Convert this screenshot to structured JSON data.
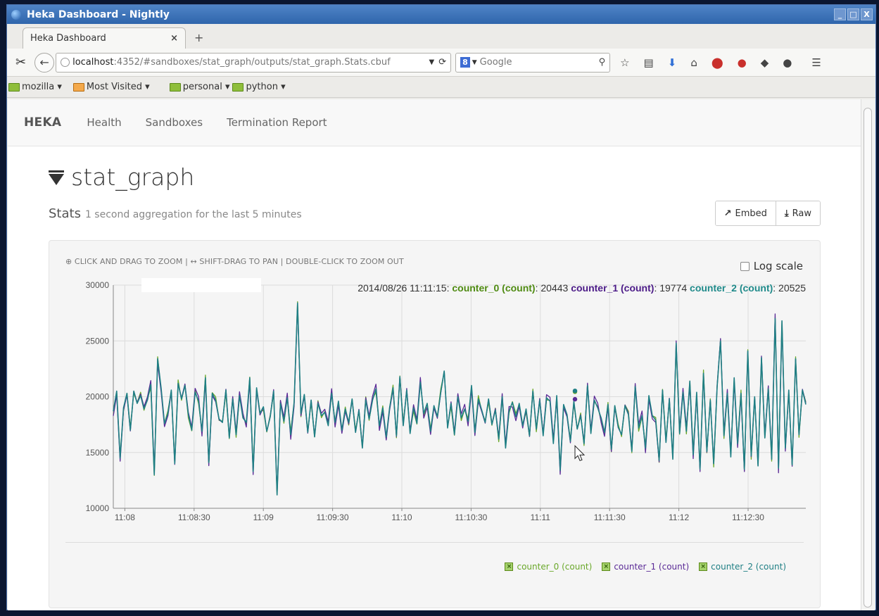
{
  "window": {
    "title": "Heka Dashboard - Nightly",
    "buttons": [
      "_",
      "□",
      "X"
    ]
  },
  "tabs": [
    {
      "label": "Heka Dashboard",
      "close": "×"
    }
  ],
  "newtab_icon": "+",
  "address": {
    "host": "localhost",
    "path": ":4352/#sandboxes/stat_graph/outputs/stat_graph.Stats.cbuf"
  },
  "search": {
    "engine_badge": "8",
    "placeholder": "Google"
  },
  "bookmarks": [
    {
      "label": "mozilla ▾",
      "icon": "folder-icon"
    },
    {
      "label": "Most Visited ▾",
      "icon": "most-visited-icon"
    },
    {
      "label": "personal ▾",
      "icon": "folder-icon"
    },
    {
      "label": "python ▾",
      "icon": "folder-icon"
    }
  ],
  "app": {
    "brand": "HEKA",
    "nav": [
      "Health",
      "Sandboxes",
      "Termination Report"
    ]
  },
  "page": {
    "title": "stat_graph",
    "section_title": "Stats",
    "section_subtitle": "1 second aggregation for the last 5 minutes",
    "embed_label": "Embed",
    "raw_label": "Raw"
  },
  "chart_panel": {
    "hint": "CLICK AND DRAG TO ZOOM | ↔ SHIFT-DRAG TO PAN | DOUBLE-CLICK TO ZOOM OUT",
    "log_scale_label": "Log scale"
  },
  "hover": {
    "time": "2014/08/26 11:11:15:",
    "items": [
      {
        "name": "counter_0 (count)",
        "value": "20443",
        "color": "#4e8a11"
      },
      {
        "name": "counter_1 (count)",
        "value": "19774",
        "color": "#4b1a87"
      },
      {
        "name": "counter_2 (count)",
        "value": "20525",
        "color": "#1f8a8a"
      }
    ]
  },
  "chart_data": {
    "type": "line",
    "title": "",
    "xlabel": "",
    "ylabel": "",
    "ylim": [
      10000,
      30000
    ],
    "yticks": [
      10000,
      15000,
      20000,
      25000,
      30000
    ],
    "xlim": [
      "11:07:55",
      "11:12:55"
    ],
    "xtick_labels": [
      "11:08",
      "11:08:30",
      "11:09",
      "11:09:30",
      "11:10",
      "11:10:30",
      "11:11",
      "11:11:30",
      "11:12",
      "11:12:30"
    ],
    "grid": true,
    "legend_position": "bottom-right",
    "series": [
      {
        "name": "counter_0 (count)",
        "color": "#6aa82a"
      },
      {
        "name": "counter_1 (count)",
        "color": "#5a2a96"
      },
      {
        "name": "counter_2 (count)",
        "color": "#1f7f84"
      }
    ],
    "base_values": [
      18700,
      20500,
      14500,
      19000,
      20300,
      17000,
      20500,
      19400,
      20100,
      18900,
      19700,
      21100,
      13000,
      23400,
      20800,
      17600,
      18500,
      20600,
      14000,
      21200,
      19800,
      21000,
      18400,
      17000,
      20400,
      19600,
      16900,
      21700,
      14100,
      20300,
      19700,
      18000,
      17700,
      20600,
      16300,
      19800,
      16600,
      20100,
      18100,
      17700,
      21700,
      13300,
      20800,
      18500,
      19100,
      16900,
      18200,
      20500,
      11200,
      19400,
      17800,
      19900,
      16600,
      19500,
      28400,
      18500,
      20200,
      16800,
      19700,
      16400,
      19400,
      18300,
      18600,
      17400,
      20300,
      17700,
      19600,
      17000,
      18900,
      17700,
      19800,
      16800,
      18800,
      15400,
      19700,
      18000,
      19700,
      20700,
      17400,
      19000,
      16400,
      19000,
      20800,
      16500,
      21800,
      17400,
      20600,
      16700,
      19000,
      17600,
      21300,
      18500,
      19400,
      16900,
      19200,
      18200,
      20400,
      22300,
      17200,
      19400,
      16600,
      20000,
      18100,
      18900,
      17800,
      21000,
      16800,
      19800,
      18800,
      17700,
      19800,
      17500,
      18800,
      16200,
      20000,
      15400,
      18700,
      19500,
      18200,
      19400,
      17400,
      18900,
      16500,
      20500,
      17100,
      19700,
      16500,
      19900,
      19600,
      15800,
      20100,
      13400,
      19300,
      18400,
      16000,
      19600,
      17100,
      18300,
      15800,
      21000,
      16700,
      19700,
      19000,
      18100,
      16800,
      19300,
      15300,
      19200,
      17300,
      16600,
      19200,
      18400,
      15100,
      20900,
      17200,
      18300,
      15400,
      20100,
      18300,
      17900,
      14300,
      20600,
      15900,
      19800,
      14400,
      24800,
      16700,
      20400,
      16900,
      21400,
      14800,
      20400,
      13500,
      22100,
      15100,
      19700,
      14000,
      20900,
      25000,
      16500,
      20300,
      14600,
      21700,
      15800,
      20300,
      13500,
      24100,
      14700,
      20000,
      13800,
      23500,
      16300,
      20700,
      14400,
      27000,
      13600,
      26800,
      15400,
      20600,
      13900,
      23400,
      16600,
      20600,
      19300
    ]
  }
}
